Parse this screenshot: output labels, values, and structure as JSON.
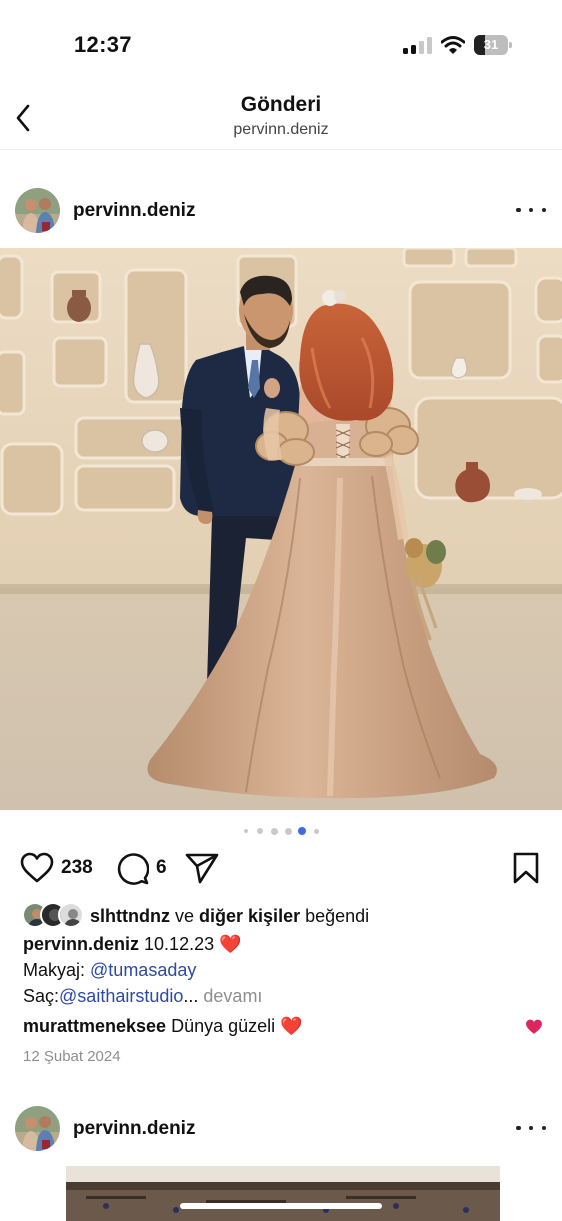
{
  "status_bar": {
    "time": "12:37",
    "battery": "31",
    "battery_level": 0.31
  },
  "header": {
    "title": "Gönderi",
    "subtitle": "pervinn.deniz"
  },
  "post": {
    "username": "pervinn.deniz",
    "carousel": {
      "total": 6,
      "active_index": 4
    },
    "likes": "238",
    "comments_count": "6",
    "liked_by_user": "slhttndnz",
    "liked_by_connector": "ve",
    "liked_by_others": "diğer kişiler",
    "liked_by_suffix": "beğendi",
    "caption_user": "pervinn.deniz",
    "caption_text": "10.12.23",
    "caption_emoji": "❤️",
    "makeup_label": "Makyaj:",
    "makeup_tag": "@tumasaday",
    "hair_label": "Saç:",
    "hair_tag": "@saithairstudio",
    "ellipsis": "...",
    "more_label": "devamı",
    "comment_user": "murattmeneksee",
    "comment_text": "Dünya güzeli",
    "comment_emoji": "❤️",
    "date": "12 Şubat 2024"
  },
  "next_post": {
    "username": "pervinn.deniz"
  },
  "colors": {
    "link": "#2d4aa5",
    "heart_red": "#e0245e",
    "active_dot": "#3d6be0"
  },
  "icons": [
    "back-arrow-icon",
    "signal-icon",
    "wifi-icon",
    "battery-icon",
    "more-icon",
    "heart-icon",
    "comment-icon",
    "share-icon",
    "bookmark-icon"
  ]
}
